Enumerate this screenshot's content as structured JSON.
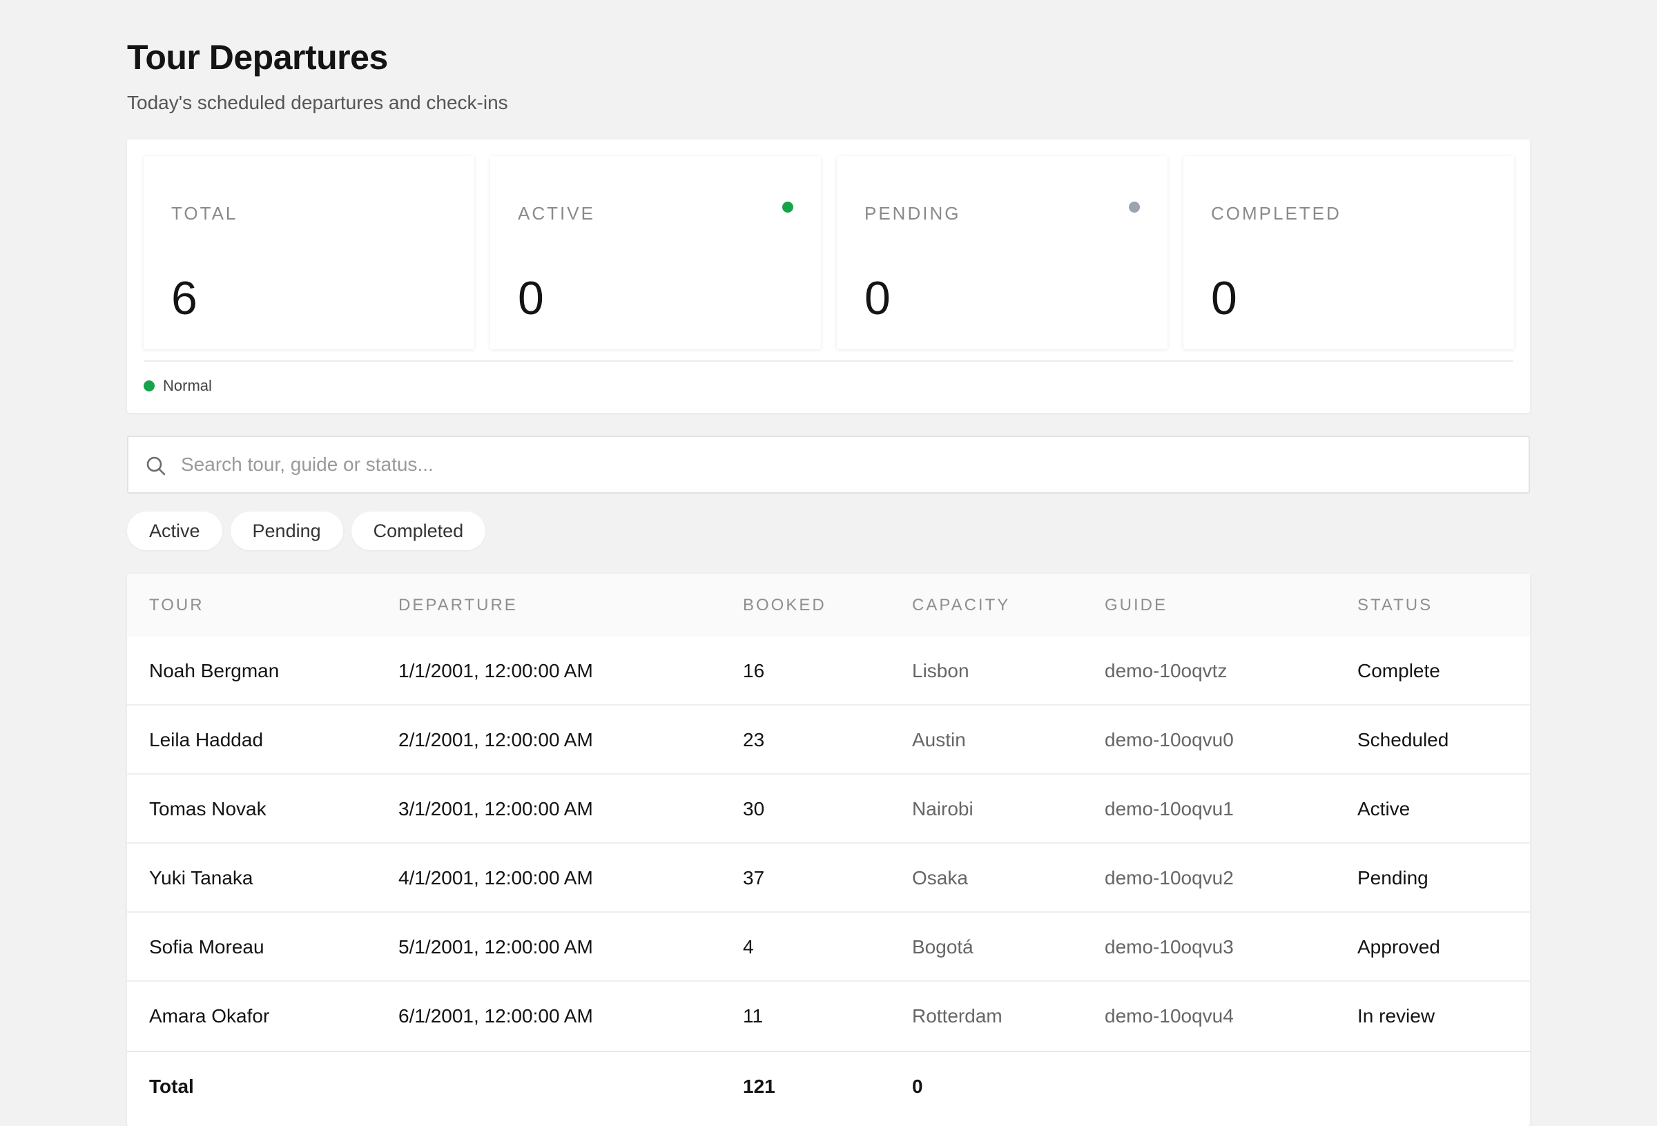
{
  "header": {
    "title": "Tour Departures",
    "subtitle": "Today's scheduled departures and check-ins"
  },
  "stats": [
    {
      "label": "TOTAL",
      "value": "6",
      "dot_color": ""
    },
    {
      "label": "ACTIVE",
      "value": "0",
      "dot_color": "#16a34a"
    },
    {
      "label": "PENDING",
      "value": "0",
      "dot_color": "#9ca3af"
    },
    {
      "label": "COMPLETED",
      "value": "0",
      "dot_color": ""
    }
  ],
  "legend": {
    "label": "Normal",
    "color": "#16a34a"
  },
  "search": {
    "placeholder": "Search tour, guide or status...",
    "value": "",
    "icon": "search-icon"
  },
  "filters": [
    "Active",
    "Pending",
    "Completed"
  ],
  "table": {
    "columns": [
      "TOUR",
      "DEPARTURE",
      "BOOKED",
      "CAPACITY",
      "GUIDE",
      "STATUS"
    ],
    "rows": [
      {
        "tour": "Noah Bergman",
        "departure": "1/1/2001, 12:00:00 AM",
        "booked": "16",
        "capacity": "Lisbon",
        "guide": "demo-10oqvtz",
        "status": "Complete"
      },
      {
        "tour": "Leila Haddad",
        "departure": "2/1/2001, 12:00:00 AM",
        "booked": "23",
        "capacity": "Austin",
        "guide": "demo-10oqvu0",
        "status": "Scheduled"
      },
      {
        "tour": "Tomas Novak",
        "departure": "3/1/2001, 12:00:00 AM",
        "booked": "30",
        "capacity": "Nairobi",
        "guide": "demo-10oqvu1",
        "status": "Active"
      },
      {
        "tour": "Yuki Tanaka",
        "departure": "4/1/2001, 12:00:00 AM",
        "booked": "37",
        "capacity": "Osaka",
        "guide": "demo-10oqvu2",
        "status": "Pending"
      },
      {
        "tour": "Sofia Moreau",
        "departure": "5/1/2001, 12:00:00 AM",
        "booked": "4",
        "capacity": "Bogotá",
        "guide": "demo-10oqvu3",
        "status": "Approved"
      },
      {
        "tour": "Amara Okafor",
        "departure": "6/1/2001, 12:00:00 AM",
        "booked": "11",
        "capacity": "Rotterdam",
        "guide": "demo-10oqvu4",
        "status": "In review"
      }
    ],
    "footer": {
      "label": "Total",
      "booked": "121",
      "capacity": "0"
    }
  }
}
